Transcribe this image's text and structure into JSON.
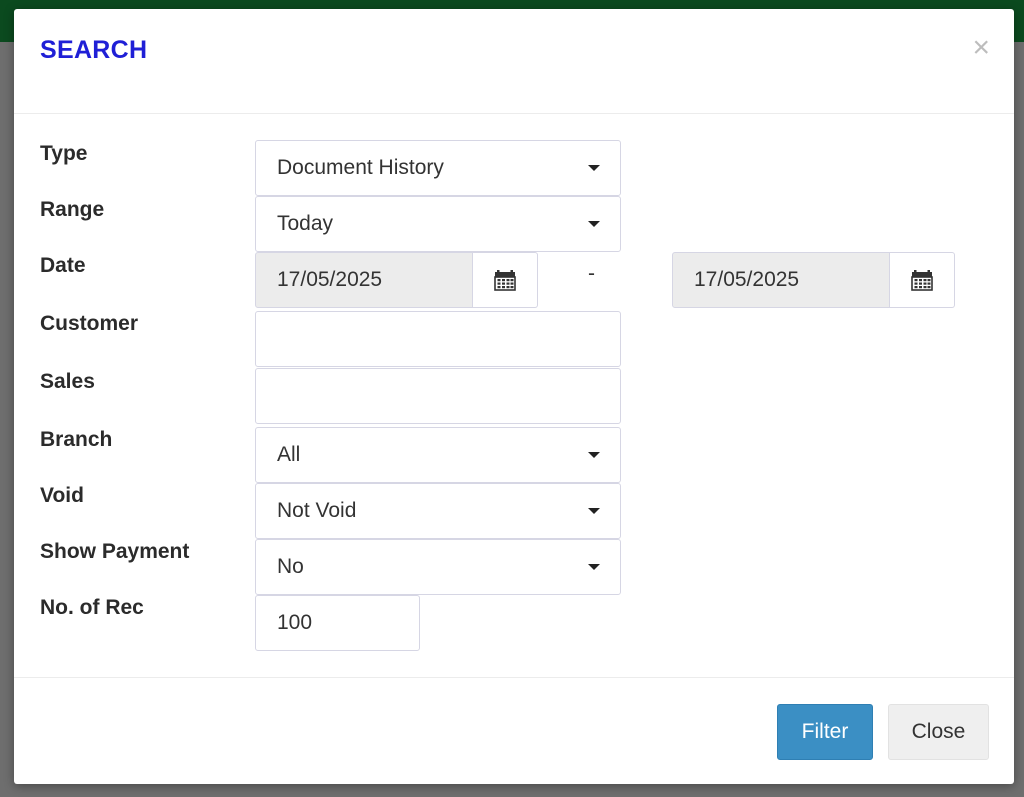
{
  "dialog": {
    "title": "SEARCH",
    "close_icon": "×"
  },
  "form": {
    "type": {
      "label": "Type",
      "value": "Document History"
    },
    "range": {
      "label": "Range",
      "value": "Today"
    },
    "date": {
      "label": "Date",
      "from": "17/05/2025",
      "separator": "-",
      "to": "17/05/2025"
    },
    "customer": {
      "label": "Customer",
      "value": ""
    },
    "sales": {
      "label": "Sales",
      "value": ""
    },
    "branch": {
      "label": "Branch",
      "value": "All"
    },
    "void": {
      "label": "Void",
      "value": "Not Void"
    },
    "show_payment": {
      "label": "Show Payment",
      "value": "No"
    },
    "no_of_rec": {
      "label": "No. of Rec",
      "value": "100"
    }
  },
  "footer": {
    "filter_label": "Filter",
    "close_label": "Close"
  },
  "icons": {
    "calendar": "calendar-icon",
    "caret": "chevron-down-icon",
    "close": "close-icon"
  },
  "colors": {
    "title": "#1f1fd6",
    "filter_button": "#3b8fc4",
    "top_strip": "#0b4a1f"
  }
}
